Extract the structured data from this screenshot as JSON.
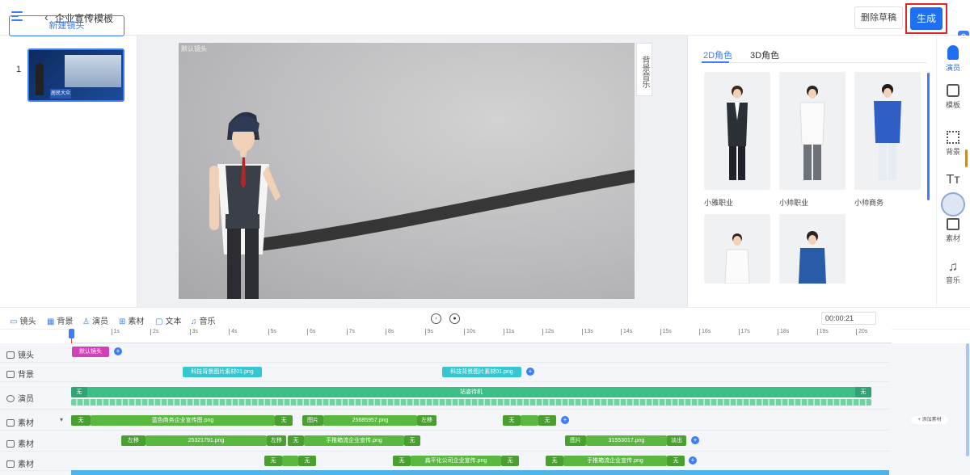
{
  "header": {
    "title": "企业宣传模板",
    "reset_label": "删除草稿",
    "generate_label": "生成"
  },
  "left": {
    "new_shot_label": "新建镜头",
    "shots": [
      {
        "index": "1",
        "caption": "居民大众"
      }
    ]
  },
  "stage": {
    "canvas_label": "默认镜头",
    "bg_music_label": "背景音乐"
  },
  "right": {
    "tabs": [
      "2D角色",
      "3D角色"
    ],
    "active_tab": "2D角色",
    "characters": [
      {
        "name": "小雅职业"
      },
      {
        "name": "小帅职业"
      },
      {
        "name": "小帅商务"
      },
      {
        "name": ""
      },
      {
        "name": ""
      }
    ]
  },
  "toolbar_right": {
    "items": [
      {
        "label": "演员",
        "icon": "person-icon"
      },
      {
        "label": "模板",
        "icon": "template-icon"
      },
      {
        "label": "背景",
        "icon": "background-icon"
      },
      {
        "label": "",
        "icon": "text-icon"
      },
      {
        "label": "",
        "icon": "avatar-icon"
      },
      {
        "label": "素材",
        "icon": "image-icon"
      },
      {
        "label": "音乐",
        "icon": "music-icon"
      }
    ]
  },
  "timeline": {
    "toolbar": [
      "镜头",
      "背景",
      "演员",
      "素材",
      "文本",
      "音乐"
    ],
    "time": "00:00:21",
    "ticks": [
      "1s",
      "2s",
      "3s",
      "4s",
      "5s",
      "6s",
      "7s",
      "8s",
      "9s",
      "10s",
      "11s",
      "12s",
      "13s",
      "14s",
      "15s",
      "16s",
      "17s",
      "18s",
      "19s",
      "20s"
    ],
    "rows": [
      {
        "label": "镜头"
      },
      {
        "label": "背景"
      },
      {
        "label": "演员"
      },
      {
        "label": "素材"
      },
      {
        "label": "素材"
      },
      {
        "label": "素材"
      }
    ],
    "clips": {
      "camera": "默认镜头",
      "bg1": "科技背景图片素材01.png",
      "bg2": "科技背景图片素材01.png",
      "actor_start": "无",
      "actor_main": "站姿待机",
      "actor_end": "无",
      "m1a_tag": "无",
      "m1a": "蓝色商务企业宣传图.png",
      "m1a_end": "无",
      "m1b_tag": "图片",
      "m1b": "25685957.png",
      "m1b_end": "左移",
      "m1c_tag": "无",
      "m1c_end": "无",
      "m2a_tag": "左移",
      "m2a": "25321791.png",
      "m2a_end": "左移",
      "m2b_tag": "无",
      "m2b": "手推箱流企业宣传.png",
      "m2b_end": "无",
      "m2c_tag": "图片",
      "m2c": "31553017.png",
      "m2c_end": "淡出",
      "m3a_tag": "无",
      "m3a_end": "无",
      "m3b_tag": "无",
      "m3b": "扁平化公司企业宣传.png",
      "m3b_end": "无",
      "m3c_tag": "无",
      "m3c": "手推箱流企业宣传.png",
      "m3c_end": "无"
    },
    "side_tag": "+ 添加素材"
  }
}
